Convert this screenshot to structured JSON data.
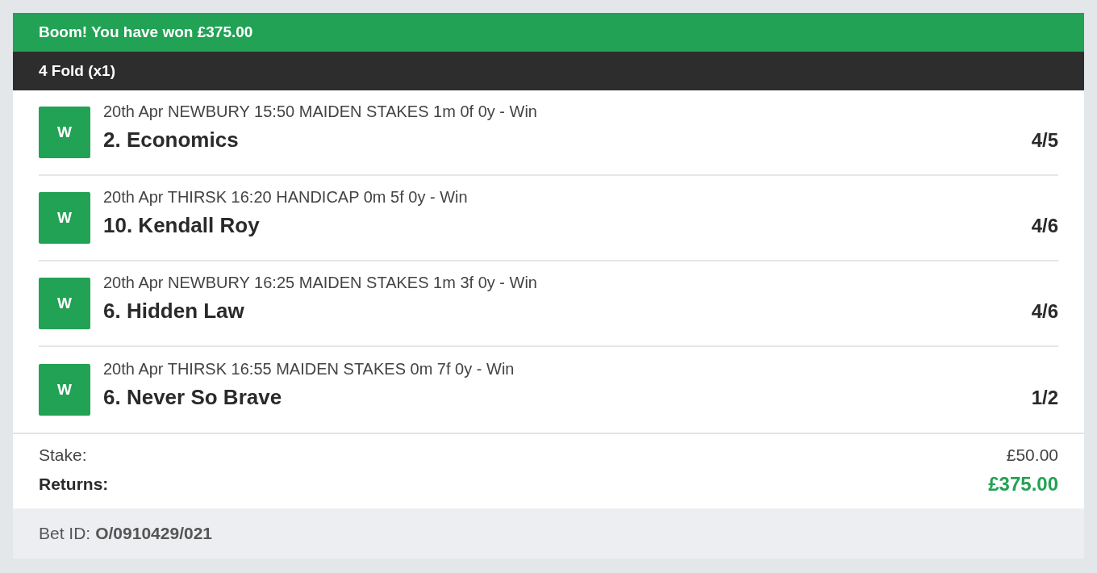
{
  "banner": {
    "title": "Boom! You have won £375.00"
  },
  "bet": {
    "title": "4 Fold (x1)"
  },
  "legs": [
    {
      "result": "W",
      "race": "20th Apr NEWBURY 15:50 MAIDEN STAKES 1m 0f 0y - Win",
      "selection": "2. Economics",
      "odds": "4/5"
    },
    {
      "result": "W",
      "race": "20th Apr THIRSK 16:20 HANDICAP 0m 5f 0y - Win",
      "selection": "10. Kendall Roy",
      "odds": "4/6"
    },
    {
      "result": "W",
      "race": "20th Apr NEWBURY 16:25 MAIDEN STAKES 1m 3f 0y - Win",
      "selection": "6. Hidden Law",
      "odds": "4/6"
    },
    {
      "result": "W",
      "race": "20th Apr THIRSK 16:55 MAIDEN STAKES 0m 7f 0y - Win",
      "selection": "6. Never So Brave",
      "odds": "1/2"
    }
  ],
  "summary": {
    "stake_label": "Stake:",
    "stake": "£50.00",
    "returns_label": "Returns:",
    "returns": "£375.00"
  },
  "footer": {
    "bet_id_label": "Bet ID:",
    "bet_id": "O/0910429/021"
  }
}
